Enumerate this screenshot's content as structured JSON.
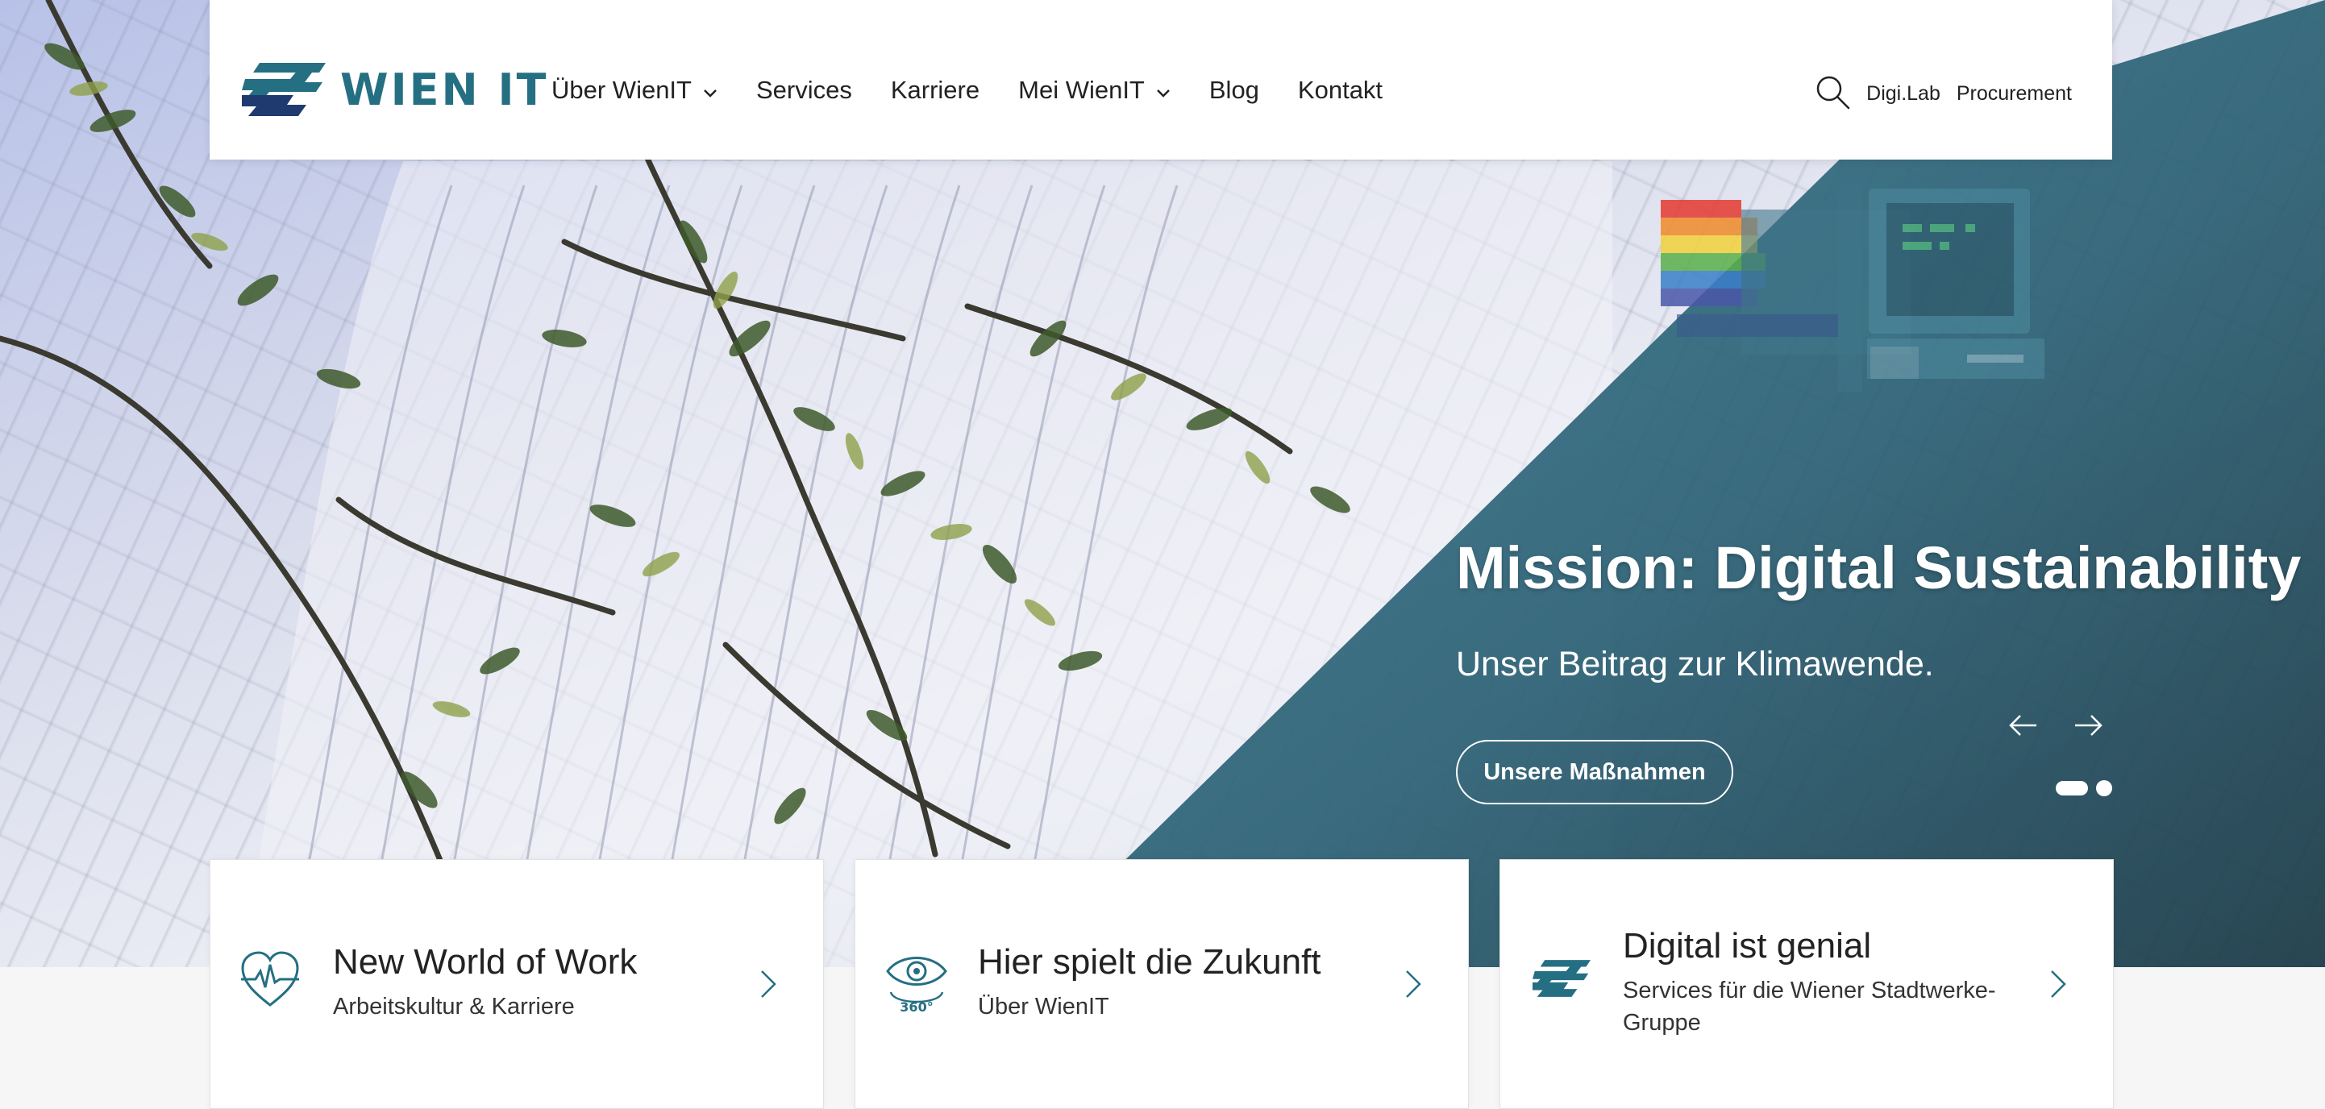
{
  "header": {
    "logo_text": "WIEN IT",
    "nav": [
      {
        "label": "Über WienIT",
        "has_dropdown": true
      },
      {
        "label": "Services",
        "has_dropdown": false
      },
      {
        "label": "Karriere",
        "has_dropdown": false
      },
      {
        "label": "Mei WienIT",
        "has_dropdown": true
      },
      {
        "label": "Blog",
        "has_dropdown": false
      },
      {
        "label": "Kontakt",
        "has_dropdown": false
      }
    ],
    "utility": {
      "search_icon": "search-icon",
      "links": [
        "Digi.Lab",
        "Procurement"
      ]
    }
  },
  "hero": {
    "title": "Mission: Digital Sustainability",
    "subtitle": "Unser Beitrag zur Klimawende.",
    "cta_label": "Unsere Maßnahmen",
    "slides_total": 2,
    "active_slide": 1
  },
  "cards": [
    {
      "icon": "heart-pulse-icon",
      "title": "New World of Work",
      "subtitle": "Arbeitskultur & Karriere"
    },
    {
      "icon": "eye-360-icon",
      "title": "Hier spielt die Zukunft",
      "subtitle": "Über WienIT"
    },
    {
      "icon": "wienit-emblem-icon",
      "title": "Digital ist genial",
      "subtitle": "Services für die Wiener Stadtwerke-Gruppe"
    }
  ],
  "colors": {
    "brand_teal": "#256f83",
    "brand_navy": "#1f3a6e",
    "hero_overlay": "#2d6478",
    "text": "#222222"
  }
}
